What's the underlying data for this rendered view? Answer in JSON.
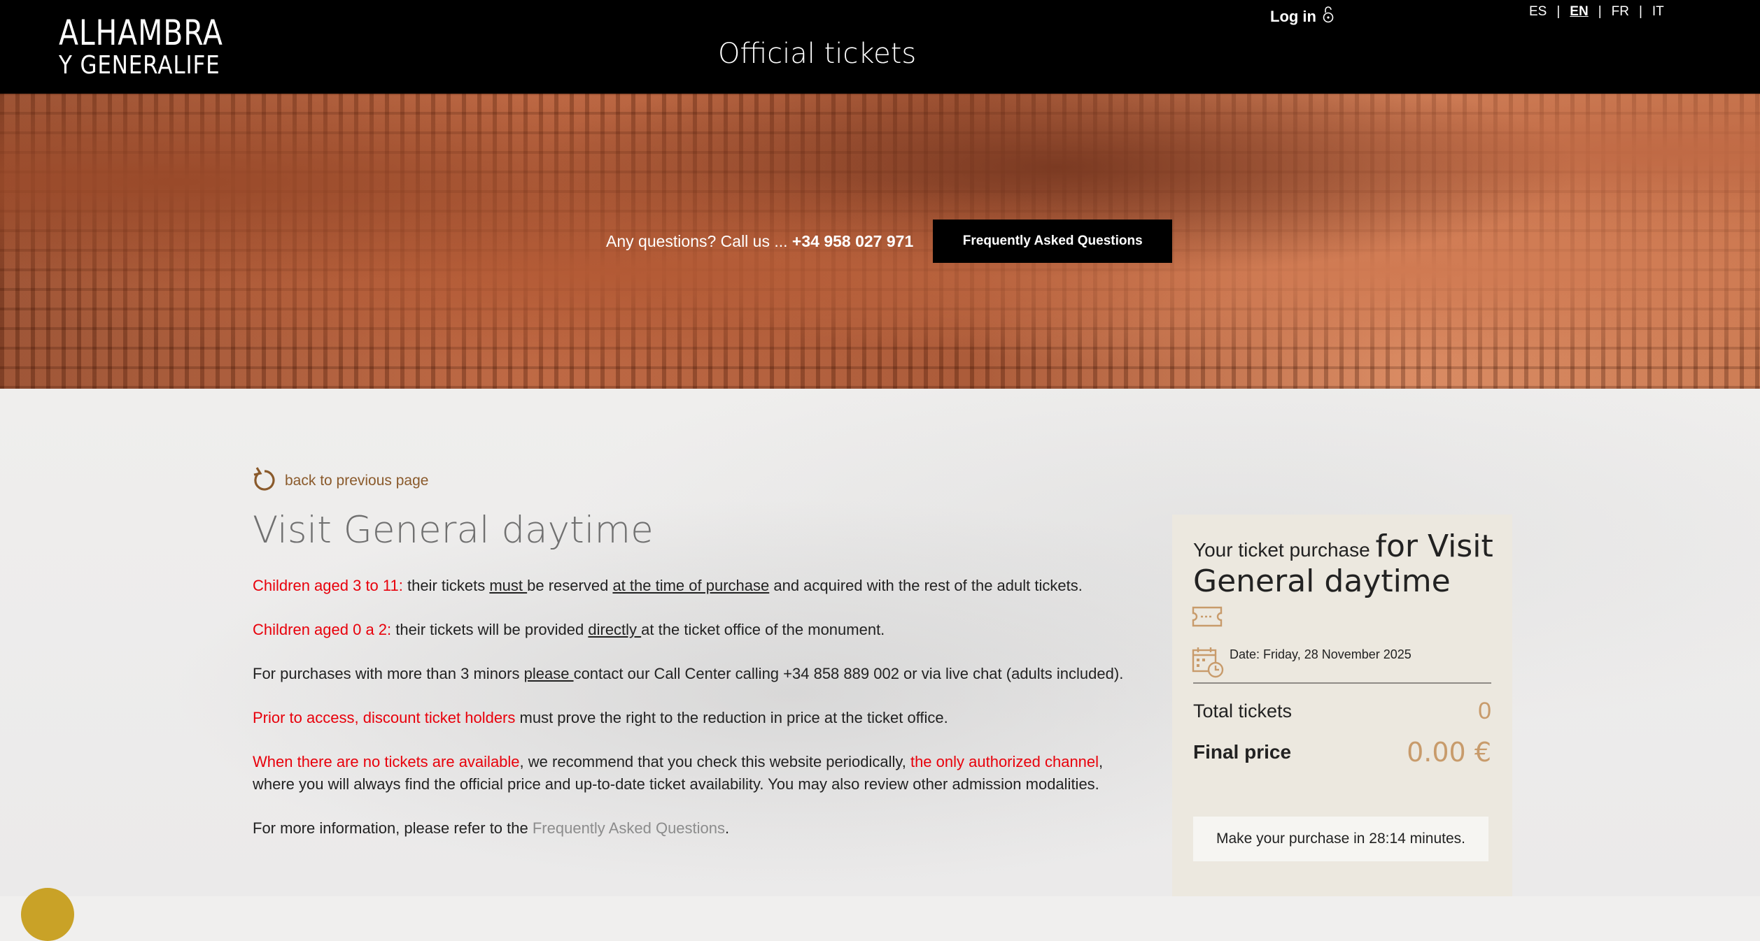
{
  "header": {
    "logo_line1": "ALHAMBRA",
    "logo_line2": "Y GENERALIFE",
    "title": "Official tickets",
    "login_label": "Log in",
    "languages": [
      "ES",
      "EN",
      "FR",
      "IT"
    ],
    "active_language": "EN",
    "separator": "|"
  },
  "hero": {
    "call_text": "Any questions? Call us ... ",
    "phone": "+34 958 027 971",
    "faq_button": "Frequently Asked Questions"
  },
  "main": {
    "back_label": "back to previous page",
    "title": "Visit General daytime",
    "p1": {
      "red": "Children aged 3 to 11:",
      "t1": " their tickets ",
      "u1": "must ",
      "t2": "be reserved ",
      "u2": "at the time of purchase",
      "t3": " and acquired with the rest of the adult tickets."
    },
    "p2": {
      "red": "Children aged 0 a 2:",
      "t1": " their tickets will be provided ",
      "u1": "directly ",
      "t2": "at the ticket office of the monument."
    },
    "p3": {
      "t1": "For purchases with more than 3 minors ",
      "u1": "please ",
      "t2": "contact our Call Center calling +34 858 889 002 or via live chat (adults included)."
    },
    "p4": {
      "red": "Prior to access, discount ticket holders",
      "t1": " must prove the right to the reduction in price at the ticket office."
    },
    "p5": {
      "red1": "When there are no tickets are available",
      "t1": ", we recommend that you check this website periodically, ",
      "red2": "the only authorized channel",
      "t2": ", where you will always find the official price and up-to-date ticket availability. You may also review other admission modalities."
    },
    "p6": {
      "t1": "For more information, please refer to the ",
      "link": "Frequently Asked Questions",
      "t2": "."
    }
  },
  "panel": {
    "head_small": "Your ticket purchase ",
    "head_big": "for Visit General daytime",
    "date": "Date: Friday, 28 November 2025",
    "total_tickets_label": "Total tickets",
    "total_tickets_value": "0",
    "final_price_label": "Final price",
    "final_price_value": "0.00 €",
    "timer_text": "Make your purchase in 28:14 minutes."
  },
  "colors": {
    "accent_gold": "#c89b6b",
    "alert_red": "#e8000b",
    "back_link": "#8a5a2b"
  }
}
